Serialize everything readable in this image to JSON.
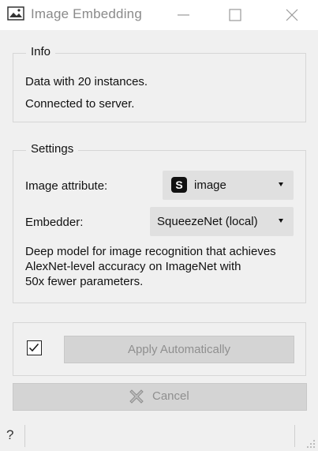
{
  "window": {
    "title": "Image Embedding",
    "icon": "image-icon"
  },
  "info": {
    "title": "Info",
    "lines": [
      "Data with 20 instances.",
      "Connected to server."
    ]
  },
  "settings": {
    "title": "Settings",
    "image_attribute_label": "Image attribute:",
    "image_attribute_value": "image",
    "image_attribute_badge": "S",
    "embedder_label": "Embedder:",
    "embedder_value": "SqueezeNet (local)",
    "description_lines": [
      "Deep model for image recognition that achieves",
      "AlexNet-level accuracy on ImageNet with",
      "50x fewer parameters."
    ]
  },
  "actions": {
    "apply_automatically_checked": true,
    "apply_label": "Apply Automatically",
    "cancel_label": "Cancel"
  },
  "statusbar": {
    "help_glyph": "?"
  }
}
